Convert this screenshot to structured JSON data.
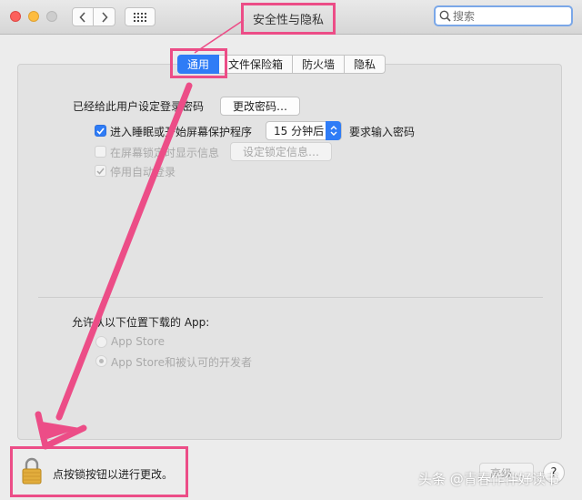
{
  "window": {
    "title": "安全性与隐私",
    "search_placeholder": "搜索"
  },
  "tabs": [
    {
      "label": "通用",
      "active": true
    },
    {
      "label": "文件保险箱",
      "active": false
    },
    {
      "label": "防火墙",
      "active": false
    },
    {
      "label": "隐私",
      "active": false
    }
  ],
  "general": {
    "password_label": "已经给此用户设定登录密码",
    "change_password_button": "更改密码…",
    "require_password": {
      "checked": true,
      "label": "进入睡眠或开始屏幕保护程序",
      "delay_value": "15 分钟后",
      "suffix": "要求输入密码"
    },
    "show_message": {
      "checked": false,
      "label": "在屏幕锁定时显示信息",
      "button": "设定锁定信息…"
    },
    "disable_autologin": {
      "checked": true,
      "label": "停用自动登录"
    }
  },
  "downloads": {
    "label": "允许从以下位置下载的 App:",
    "options": [
      {
        "label": "App Store",
        "selected": false
      },
      {
        "label": "App Store和被认可的开发者",
        "selected": true
      }
    ]
  },
  "footer": {
    "lock_message": "点按锁按钮以进行更改。",
    "advanced_button": "高级…",
    "help_button": "?"
  },
  "watermark": "头条 @青春作伴好读书",
  "colors": {
    "accent": "#2f7cf6",
    "annotation": "#ec4d87"
  }
}
